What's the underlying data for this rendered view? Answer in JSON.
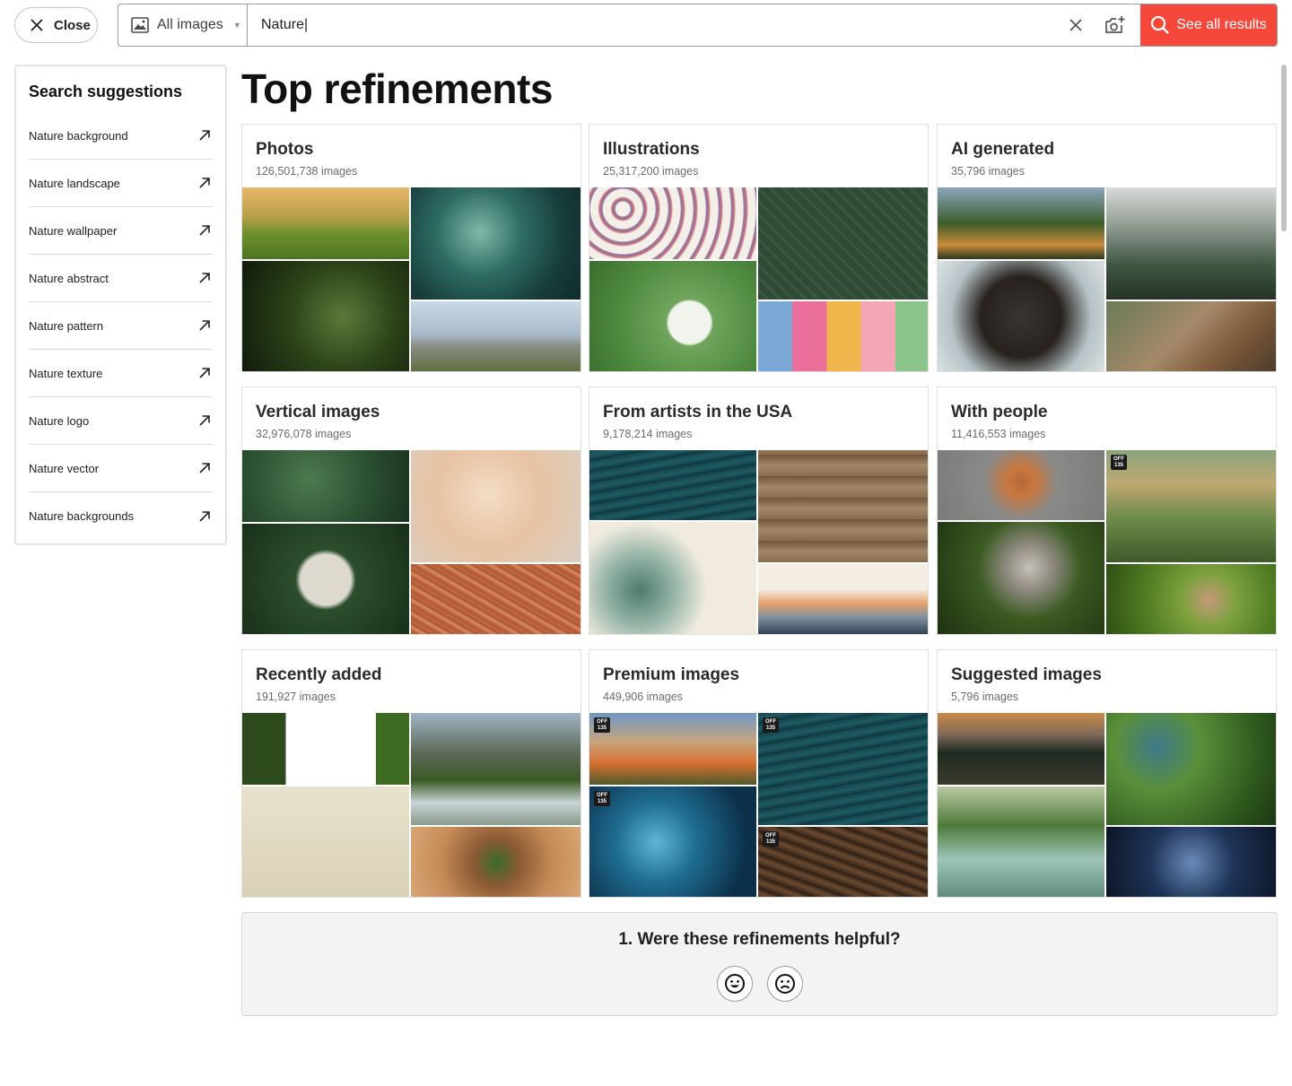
{
  "header": {
    "close_label": "Close",
    "type_select": "All images",
    "search_value": "Nature|",
    "see_all_label": "See all results"
  },
  "suggestions": {
    "title": "Search suggestions",
    "items": [
      "Nature background",
      "Nature landscape",
      "Nature wallpaper",
      "Nature abstract",
      "Nature pattern",
      "Nature texture",
      "Nature logo",
      "Nature vector",
      "Nature backgrounds"
    ]
  },
  "main": {
    "title": "Top refinements",
    "cards": [
      {
        "title": "Photos",
        "count": "126,501,738 images"
      },
      {
        "title": "Illustrations",
        "count": "25,317,200 images"
      },
      {
        "title": "AI generated",
        "count": "35,796 images"
      },
      {
        "title": "Vertical images",
        "count": "32,976,078  images"
      },
      {
        "title": "From artists in the USA",
        "count": "9,178,214 images"
      },
      {
        "title": "With people",
        "count": "11,416,553 images"
      },
      {
        "title": "Recently added",
        "count": "191,927 images"
      },
      {
        "title": "Premium images",
        "count": "449,906 images"
      },
      {
        "title": "Suggested images",
        "count": "5,796 images"
      }
    ],
    "badge_text": "OFF 135"
  },
  "feedback": {
    "question": "1.  Were these refinements helpful?",
    "positive_icon": "smile-icon",
    "negative_icon": "frown-icon"
  },
  "colors": {
    "accent": "#f5483b",
    "panel_border": "#e3e3e3",
    "feedback_bg": "#f3f3f4"
  }
}
